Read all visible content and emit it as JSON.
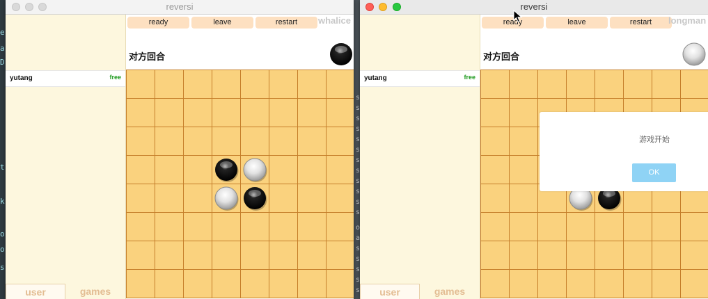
{
  "colors": {
    "board": "#fad27e",
    "grid": "#c57e2a",
    "button": "#fde0c1",
    "sidebar": "#fdf7de",
    "ok_button": "#8fd3f5",
    "status_free": "#1e9a1e"
  },
  "background": {
    "terminal_chars": [
      "e",
      "a",
      "D",
      "t",
      "k",
      "o",
      "o",
      "s"
    ],
    "strip_chars": [
      "s",
      "s",
      "s",
      "s",
      "s",
      "s",
      "s",
      "s",
      "s",
      "s",
      "s",
      "s",
      "o",
      "a",
      "s",
      "s",
      "s",
      "s",
      "s"
    ]
  },
  "windows": [
    {
      "title": "reversi",
      "active": false,
      "buttons": {
        "ready": "ready",
        "leave": "leave",
        "restart": "restart"
      },
      "username": "whalice",
      "turn_text": "对方回合",
      "my_piece_icon": "black-piece-icon",
      "player": {
        "name": "yutang",
        "status": "free"
      },
      "tabs": {
        "user": "user",
        "games": "games"
      },
      "board": {
        "rows": 8,
        "cols": 8,
        "pieces": [
          {
            "row": 3,
            "col": 3,
            "color": "black"
          },
          {
            "row": 3,
            "col": 4,
            "color": "white"
          },
          {
            "row": 4,
            "col": 3,
            "color": "white"
          },
          {
            "row": 4,
            "col": 4,
            "color": "black"
          }
        ]
      }
    },
    {
      "title": "reversi",
      "active": true,
      "buttons": {
        "ready": "ready",
        "leave": "leave",
        "restart": "restart"
      },
      "username": "longman",
      "turn_text": "对方回合",
      "my_piece_icon": "white-piece-icon",
      "player": {
        "name": "yutang",
        "status": "free"
      },
      "tabs": {
        "user": "user",
        "games": "games"
      },
      "board": {
        "rows": 8,
        "cols": 8,
        "pieces": [
          {
            "row": 4,
            "col": 3,
            "color": "white"
          },
          {
            "row": 4,
            "col": 4,
            "color": "black"
          }
        ]
      },
      "dialog": {
        "message": "游戏开始",
        "ok_label": "OK"
      }
    }
  ]
}
